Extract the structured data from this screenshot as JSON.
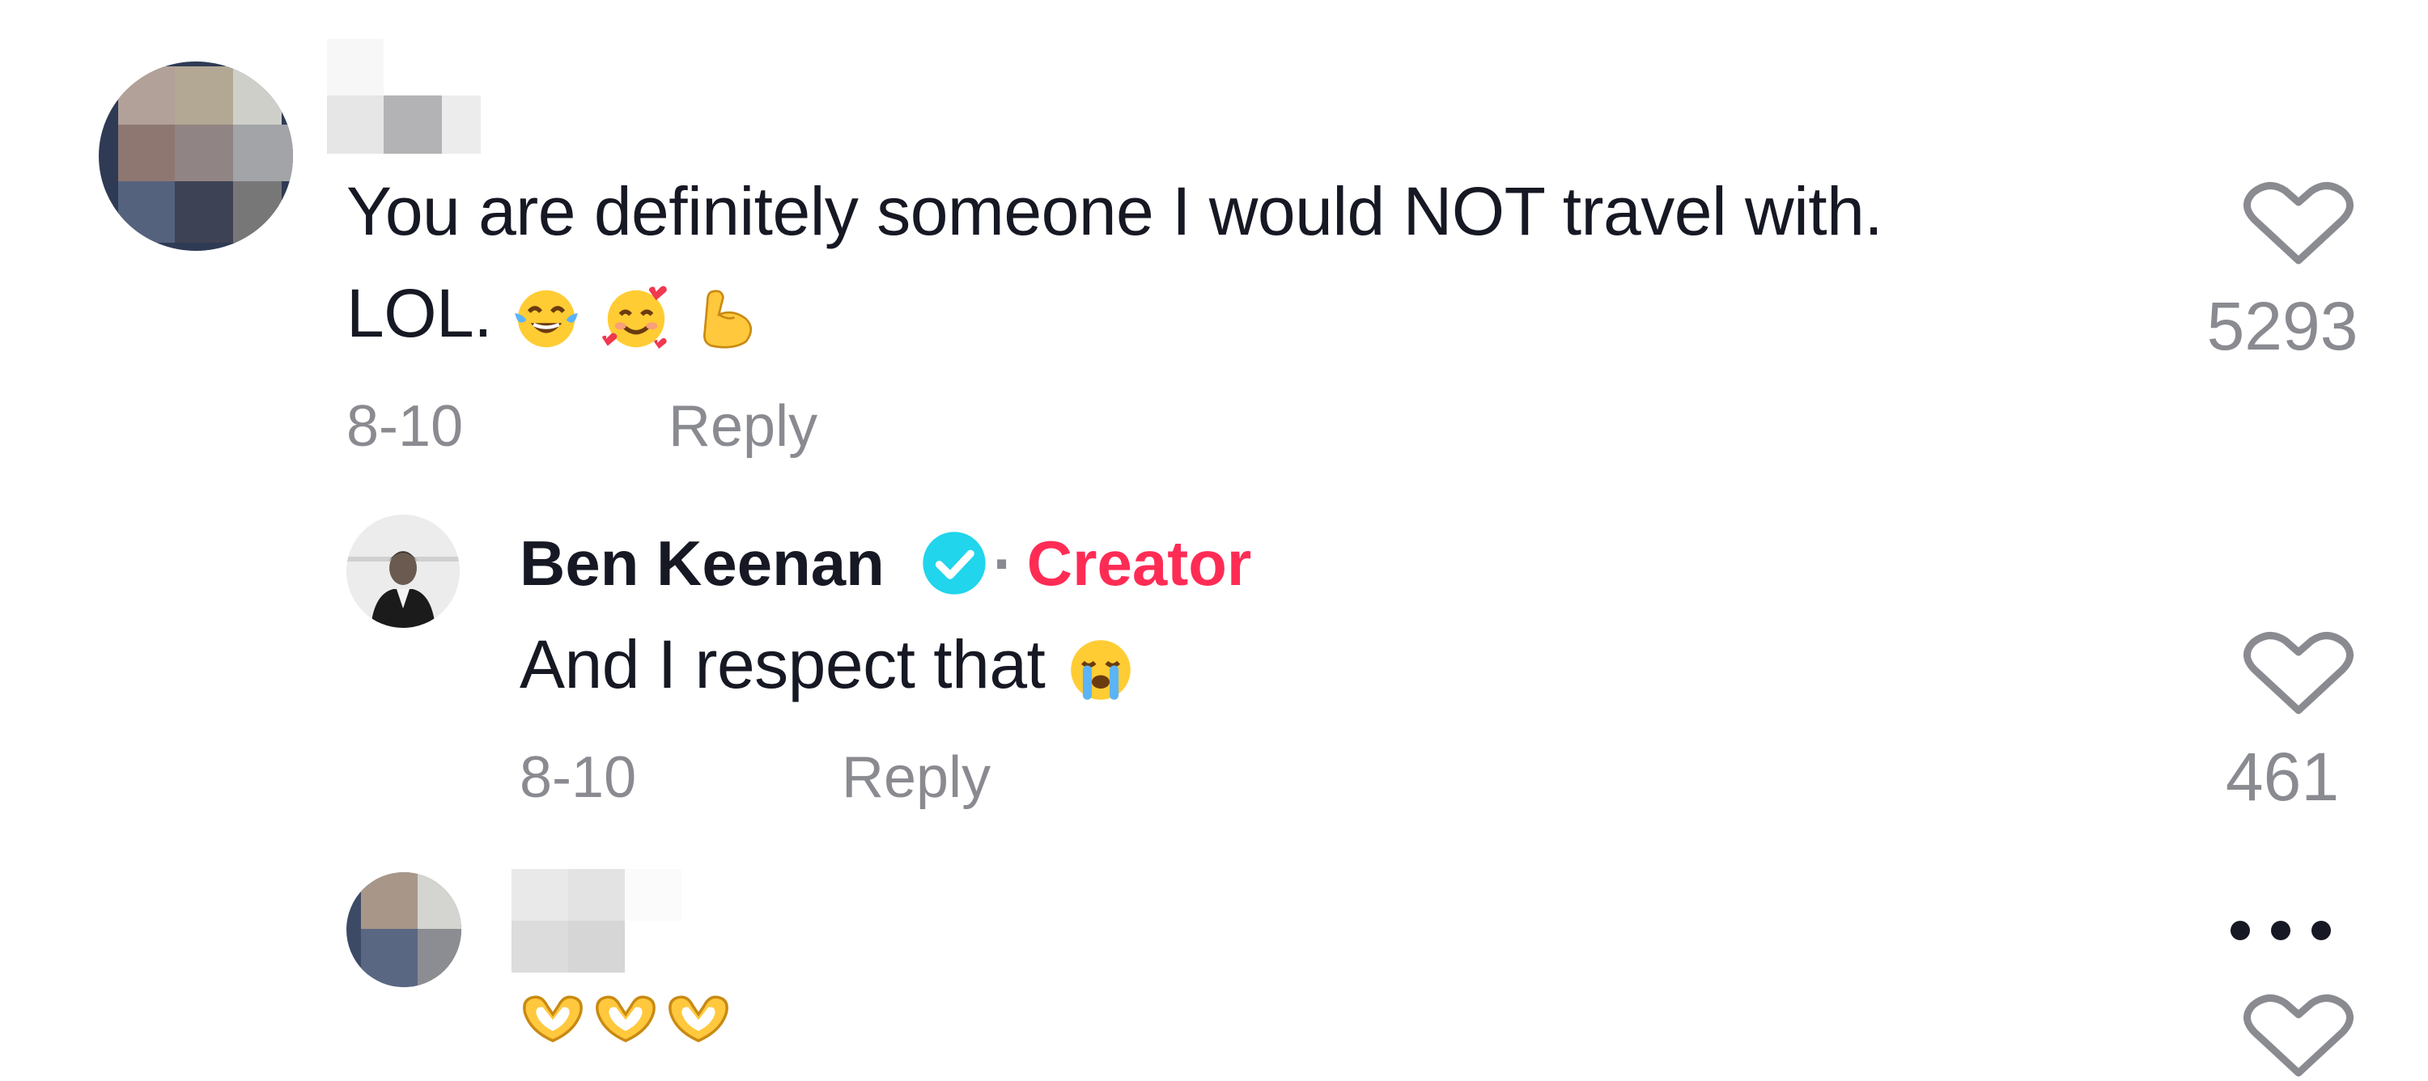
{
  "comments": [
    {
      "text_line1": "You are definitely someone I would NOT travel with.",
      "text_line2": "LOL.",
      "emojis": [
        "face-with-tears-of-joy",
        "smiling-face-with-hearts",
        "flexed-biceps"
      ],
      "date": "8-10",
      "reply_label": "Reply",
      "like_count": "5293"
    },
    {
      "username": "Ben Keenan",
      "verified": true,
      "separator": "·",
      "badge": "Creator",
      "text": "And I respect that",
      "emojis": [
        "loudly-crying-face"
      ],
      "date": "8-10",
      "reply_label": "Reply",
      "like_count": "461"
    },
    {
      "emojis": [
        "heart-hands",
        "heart-hands",
        "heart-hands"
      ],
      "more_icon": "ellipsis-icon"
    }
  ],
  "colors": {
    "text": "#161823",
    "muted": "#8a8b91",
    "creator": "#fe2c55",
    "verified": "#20d5ec"
  }
}
